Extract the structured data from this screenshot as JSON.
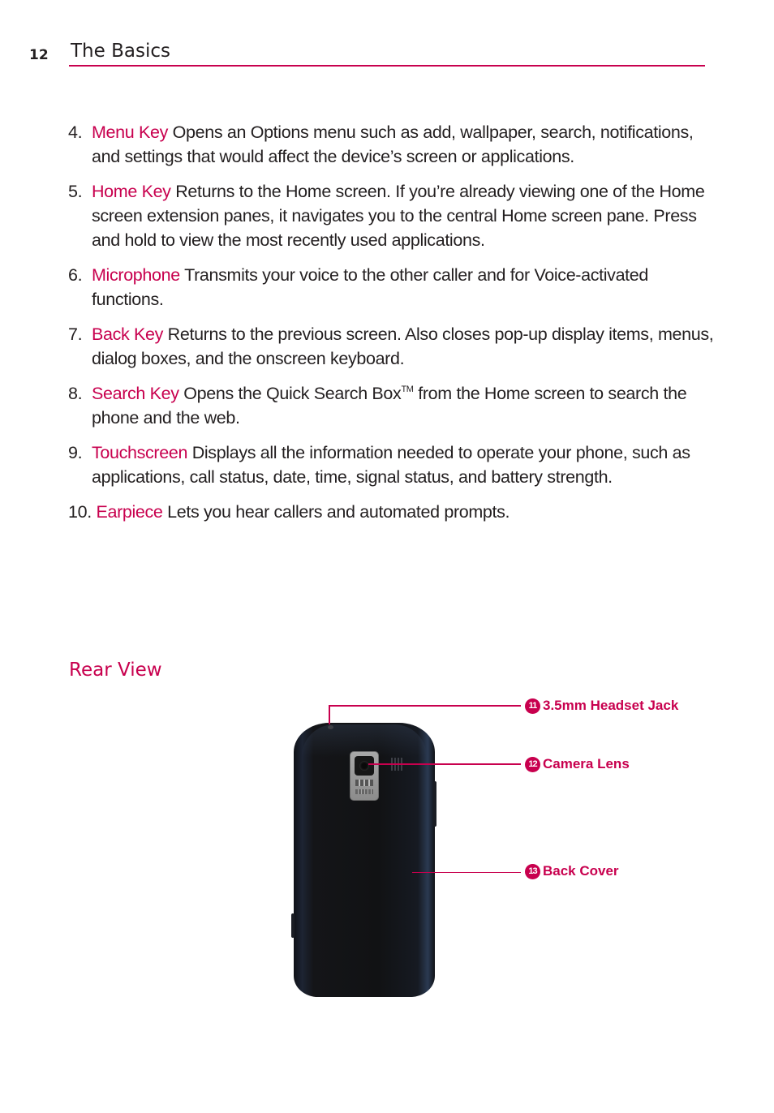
{
  "header": {
    "page_number": "12",
    "section_title": "The Basics"
  },
  "colors": {
    "accent": "#c8004e",
    "text": "#231f20"
  },
  "items": [
    {
      "number": "4.",
      "term": "Menu Key",
      "description": "Opens an Options menu such as add, wallpaper, search, notifications, and settings that would affect the device’s screen or applications."
    },
    {
      "number": "5.",
      "term": "Home Key",
      "description": "Returns to the Home screen. If you’re already viewing one of the Home screen extension panes, it navigates you to the central Home screen pane. Press and hold to view the most recently used applications."
    },
    {
      "number": "6.",
      "term": "Microphone",
      "description": "Transmits your voice to the other caller and for Voice-activated functions."
    },
    {
      "number": "7.",
      "term": "Back Key",
      "description": "Returns to the previous screen. Also closes pop-up display items, menus, dialog boxes, and the onscreen keyboard."
    },
    {
      "number": "8.",
      "term": "Search Key",
      "description_before": "Opens the Quick Search Box",
      "trademark": "TM",
      "description_after": "from the Home screen to search the phone and the web."
    },
    {
      "number": "9.",
      "term": "Touchscreen",
      "description": "Displays all the information needed to operate your phone, such as applications, call status, date, time, signal status, and battery strength."
    },
    {
      "number": "10.",
      "term": "Earpiece",
      "description": "Lets you hear callers and automated prompts."
    }
  ],
  "rear_view": {
    "heading": "Rear View",
    "callouts": [
      {
        "number": "11",
        "label": "3.5mm Headset Jack"
      },
      {
        "number": "12",
        "label": "Camera Lens"
      },
      {
        "number": "13",
        "label": "Back Cover"
      }
    ]
  }
}
